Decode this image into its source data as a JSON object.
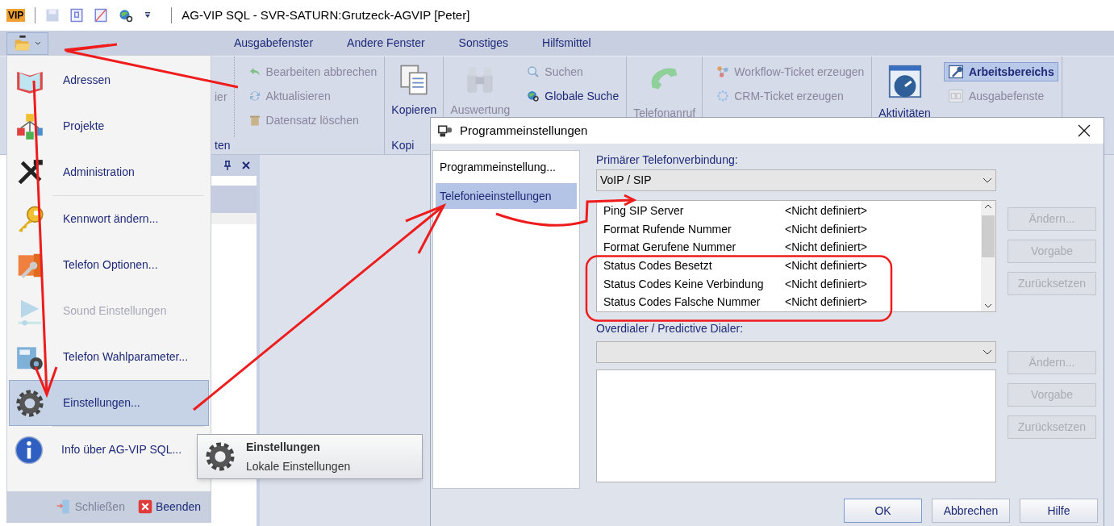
{
  "title_bar": {
    "logo": "VIP",
    "title": "AG-VIP SQL - SVR-SATURN:Grutzeck-AGVIP [Peter]"
  },
  "ribbon_tabs": [
    {
      "label": "Ausgabefenster"
    },
    {
      "label": "Andere Fenster"
    },
    {
      "label": "Sonstiges"
    },
    {
      "label": "Hilfsmittel"
    }
  ],
  "ribbon_groups": [
    {
      "label": "ten",
      "columns": [
        {
          "kind": "cut",
          "items": [
            {
              "label": "ier",
              "disabled": true
            }
          ]
        },
        {
          "kind": "small",
          "items": [
            {
              "label": "Bearbeiten abbrechen",
              "disabled": true
            },
            {
              "label": "Aktualisieren",
              "disabled": true
            },
            {
              "label": "Datensatz löschen",
              "disabled": true
            }
          ]
        }
      ]
    },
    {
      "label": "Kopi",
      "columns": [
        {
          "kind": "large",
          "items": [
            {
              "label": "Kopieren",
              "disabled": false
            }
          ]
        }
      ]
    },
    {
      "columns": [
        {
          "kind": "large",
          "items": [
            {
              "label": "Auswertung",
              "disabled": true
            }
          ]
        },
        {
          "kind": "small",
          "items": [
            {
              "label": "Suchen",
              "disabled": true
            },
            {
              "label": "Globale Suche",
              "disabled": false
            }
          ]
        }
      ]
    },
    {
      "columns": [
        {
          "kind": "large",
          "items": [
            {
              "label": "Telefonanruf",
              "disabled": true
            }
          ]
        }
      ]
    },
    {
      "columns": [
        {
          "kind": "small",
          "items": [
            {
              "label": "Workflow-Ticket erzeugen",
              "disabled": true
            },
            {
              "label": "CRM-Ticket erzeugen",
              "disabled": true
            }
          ]
        }
      ]
    },
    {
      "columns": [
        {
          "kind": "large",
          "items": [
            {
              "label": "Aktivitäten",
              "disabled": false
            }
          ]
        },
        {
          "kind": "small",
          "items": [
            {
              "label": "Arbeitsbereichs",
              "disabled": false,
              "selected": true
            },
            {
              "label": "Ausgabefenste",
              "disabled": true,
              "selected": false
            }
          ]
        }
      ]
    }
  ],
  "app_menu": {
    "items": [
      {
        "label": "Adressen",
        "disabled": false,
        "selected": false
      },
      {
        "label": "Projekte",
        "disabled": false,
        "selected": false
      },
      {
        "label": "Administration",
        "disabled": false,
        "selected": false
      },
      {
        "label": "Kennwort ändern...",
        "disabled": false,
        "selected": false
      },
      {
        "label": "Telefon Optionen...",
        "disabled": false,
        "selected": false
      },
      {
        "label": "Sound Einstellungen",
        "disabled": true,
        "selected": false
      },
      {
        "label": "Telefon Wahlparameter...",
        "disabled": false,
        "selected": false
      },
      {
        "label": "Einstellungen...",
        "disabled": false,
        "selected": true
      },
      {
        "label": "Info über AG-VIP SQL...",
        "disabled": false,
        "selected": false
      }
    ],
    "footer": [
      {
        "label": "Schließen",
        "disabled": true
      },
      {
        "label": "Beenden",
        "disabled": false
      }
    ]
  },
  "submenu": {
    "title": "Einstellungen",
    "description": "Lokale Einstellungen"
  },
  "dialog": {
    "title": "Programmeinstellungen",
    "nav": [
      {
        "label": "Programmeinstellung...",
        "selected": false
      },
      {
        "label": "Telefonieeinstellungen",
        "selected": true
      }
    ],
    "primary_label": "Primärer Telefonverbindung:",
    "primary_value": "VoIP / SIP",
    "settings": [
      {
        "name": "Ping SIP Server",
        "value": "<Nicht definiert>"
      },
      {
        "name": "Format Rufende Nummer",
        "value": "<Nicht definiert>"
      },
      {
        "name": "Format Gerufene Nummer",
        "value": "<Nicht definiert>"
      },
      {
        "name": "Status Codes Besetzt",
        "value": "<Nicht definiert>"
      },
      {
        "name": "Status Codes Keine Verbindung",
        "value": "<Nicht definiert>"
      },
      {
        "name": "Status Codes Falsche Nummer",
        "value": "<Nicht definiert>"
      }
    ],
    "side_buttons": [
      {
        "label": "Ändern...",
        "disabled": true
      },
      {
        "label": "Vorgabe",
        "disabled": true
      },
      {
        "label": "Zurücksetzen",
        "disabled": true
      }
    ],
    "overdialer_label": "Overdialer / Predictive Dialer:",
    "overdialer_buttons": [
      {
        "label": "Ändern...",
        "disabled": true
      },
      {
        "label": "Vorgabe",
        "disabled": true
      },
      {
        "label": "Zurücksetzen",
        "disabled": true
      }
    ],
    "footer_buttons": [
      {
        "label": "OK",
        "default": true
      },
      {
        "label": "Abbrechen",
        "default": false
      },
      {
        "label": "Hilfe",
        "default": false
      }
    ]
  }
}
